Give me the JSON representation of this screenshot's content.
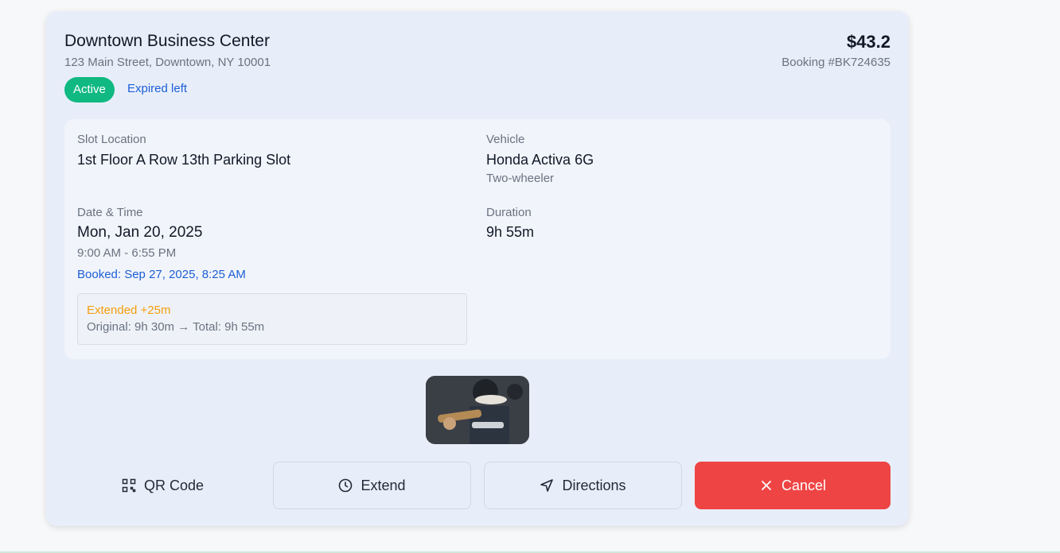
{
  "booking": {
    "title": "Downtown Business Center",
    "address": "123 Main Street, Downtown, NY 10001",
    "price": "$43.2",
    "booking_number": "Booking #BK724635",
    "status_badge": "Active",
    "expired_text": "Expired left"
  },
  "details": {
    "slot_label": "Slot Location",
    "slot_value": "1st Floor A Row 13th Parking Slot",
    "vehicle_label": "Vehicle",
    "vehicle_value": "Honda Activa 6G",
    "vehicle_type": "Two-wheeler",
    "datetime_label": "Date & Time",
    "date_value": "Mon, Jan 20, 2025",
    "time_range": "9:00 AM - 6:55 PM",
    "booked_text": "Booked: Sep 27, 2025, 8:25 AM",
    "duration_label": "Duration",
    "duration_value": "9h 55m",
    "extension_title": "Extended +25m",
    "extension_detail": "Original: 9h 30m → Total: 9h 55m"
  },
  "actions": {
    "qr_label": "QR Code",
    "extend_label": "Extend",
    "directions_label": "Directions",
    "cancel_label": "Cancel"
  },
  "icons": {
    "qr": "qr-code-icon",
    "extend": "clock-icon",
    "directions": "navigation-arrow-icon",
    "cancel": "close-icon"
  },
  "colors": {
    "active": "#10b981",
    "link": "#1d5fd6",
    "extension": "#f59e0b",
    "danger": "#ef4444"
  }
}
